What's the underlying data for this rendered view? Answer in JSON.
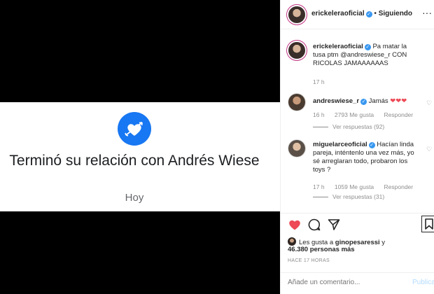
{
  "card": {
    "title": "Terminó su relación con Andrés Wiese",
    "date": "Hoy",
    "icon": "heart-arrow-icon",
    "accent": "#1877f2"
  },
  "header": {
    "username": "erickeleraoficial",
    "separator": "•",
    "follow_status": "Siguiendo",
    "more": "···"
  },
  "caption": {
    "username": "erickeleraoficial",
    "text": "Pa matar la tusa ptm @andreswiese_r CON RICOLAS JAMAAAAAAS",
    "time": "17 h"
  },
  "comments": [
    {
      "username": "andreswiese_r",
      "text": "Jamás",
      "hearts": "❤❤❤",
      "time": "16 h",
      "likes": "2793 Me gusta",
      "reply": "Responder",
      "view_replies": "Ver respuestas (92)"
    },
    {
      "username": "miguelarceoficial",
      "text": "Hacían linda pareja, inténtenlo una vez más, yo sé arreglaran todo, probaron los toys ?",
      "time": "17 h",
      "likes": "1059 Me gusta",
      "reply": "Responder",
      "view_replies": "Ver respuestas (31)"
    }
  ],
  "likes": {
    "prefix": "Les gusta a",
    "user": "ginopesaressi",
    "connector": "y",
    "count": "46.380 personas más"
  },
  "time_ago": "HACE 17 HORAS",
  "add_comment": {
    "placeholder": "Añade un comentario...",
    "publish": "Publicar"
  },
  "colors": {
    "verified": "#3897f0",
    "heart_red": "#ed4956",
    "link_blue": "#b3dbff"
  }
}
